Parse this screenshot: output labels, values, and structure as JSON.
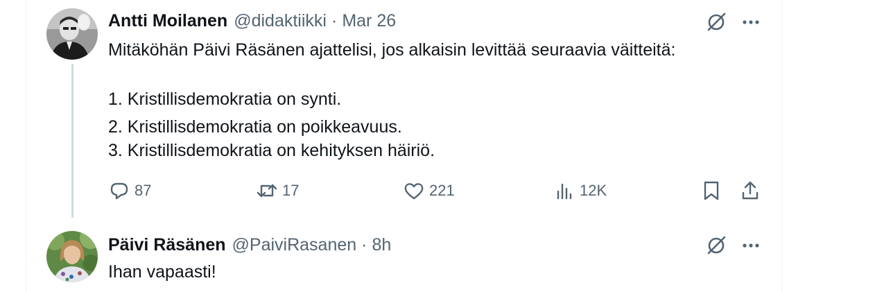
{
  "tweet1": {
    "name": "Antti Moilanen",
    "handle": "@didaktiikki",
    "separator": "·",
    "time": "Mar 26",
    "lines": [
      "Mitäköhän Päivi Räsänen ajattelisi, jos alkaisin levittää seuraavia väitteitä:",
      "1. Kristillisdemokratia on synti.",
      "2. Kristillisdemokratia on poikkeavuus.",
      "3. Kristillisdemokratia on kehityksen häiriö."
    ],
    "actions": {
      "replies": "87",
      "retweets": "17",
      "likes": "221",
      "views": "12K"
    }
  },
  "tweet2": {
    "name": "Päivi Räsänen",
    "handle": "@PaiviRasanen",
    "separator": "·",
    "time": "8h",
    "text": "Ihan vapaasti!"
  },
  "icons": {
    "grok": "grok-icon",
    "more": "more-icon",
    "reply": "reply-icon",
    "retweet": "retweet-icon",
    "like": "heart-icon",
    "views": "analytics-icon",
    "bookmark": "bookmark-icon",
    "share": "share-icon"
  },
  "colors": {
    "text": "#0f1419",
    "secondary": "#536471",
    "thread_line": "#cfd9de",
    "border": "#eff3f4"
  }
}
